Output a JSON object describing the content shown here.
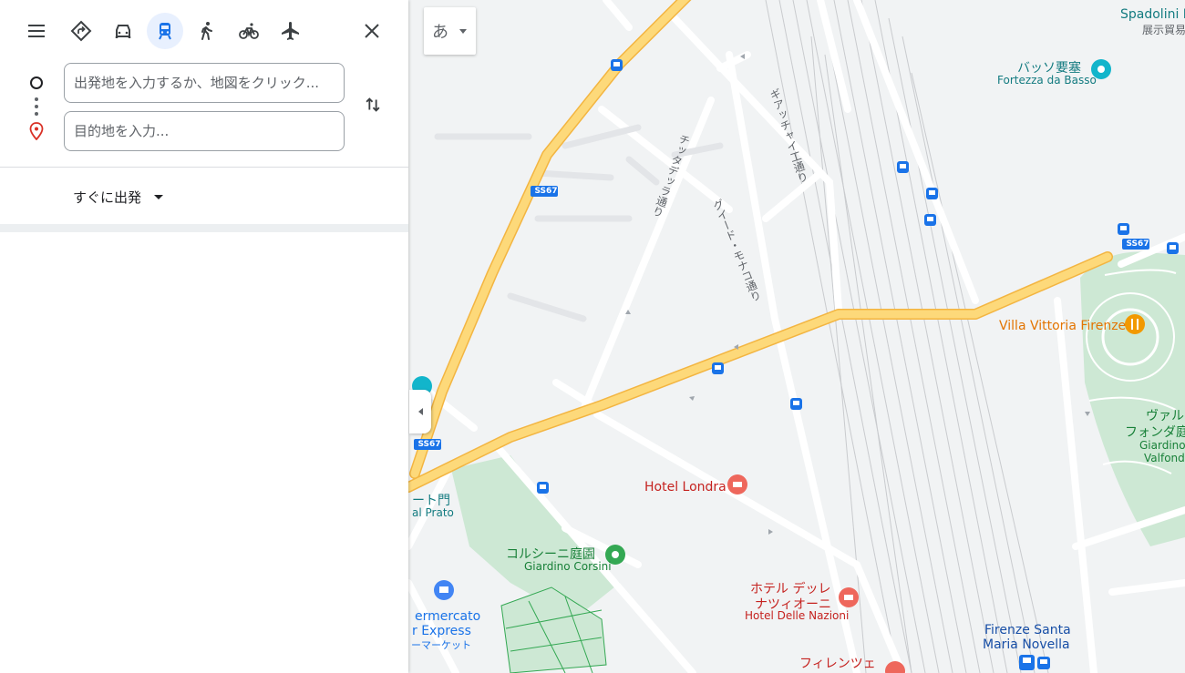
{
  "travel_modes": {
    "menu_icon": "menu-icon",
    "best": "directions-icon",
    "driving": "car-icon",
    "transit": "train-icon",
    "walking": "walk-icon",
    "cycling": "bike-icon",
    "flights": "plane-icon",
    "close": "close-icon",
    "active": "transit"
  },
  "origin": {
    "placeholder": "出発地を入力するか、地図をクリック...",
    "value": ""
  },
  "destination": {
    "placeholder": "目的地を入力...",
    "value": ""
  },
  "depart_label": "すぐに出発",
  "map": {
    "ime_button": "あ",
    "labels": {
      "spadolini": "Spadolini P",
      "spadolini_sub": "展示貿易",
      "fortezza_ja": "バッソ要塞",
      "fortezza_it": "Fortezza da Basso",
      "villa": "Villa Vittoria Firenze",
      "valfonda_ja1": "ヴァル",
      "valfonda_ja2": "フォンダ庭",
      "valfonda_it1": "Giardino d",
      "valfonda_it2": "Valfonda",
      "hotel_londra": "Hotel Londra",
      "nazioni_ja1": "ホテル デッレ",
      "nazioni_ja2": "ナツィオーニ",
      "nazioni_it": "Hotel Delle Nazioni",
      "corsini_ja": "コルシーニ庭園",
      "corsini_it": "Giardino Corsini",
      "smn1": "Firenze Santa",
      "smn2": "Maria Novella",
      "florence_ja": "フィレンツェ",
      "porta_ja": "ート門",
      "porta_it": "al Prato",
      "super1": "ermercato",
      "super2": "r Express",
      "super3": "ーマーケット",
      "street1": "チッタデッラ通り",
      "street2": "ギアッチャイ工通り",
      "street3": "グイード・モナコ通り",
      "ss67": "SS67"
    },
    "colors": {
      "map_bg": "#f1f3f4",
      "road": "#ffffff",
      "highway": "#fdd97a",
      "highway_edge": "#f3b541",
      "park": "#cde8d4",
      "rail": "#c9cbce",
      "transit_blue": "#1a73e8"
    }
  }
}
